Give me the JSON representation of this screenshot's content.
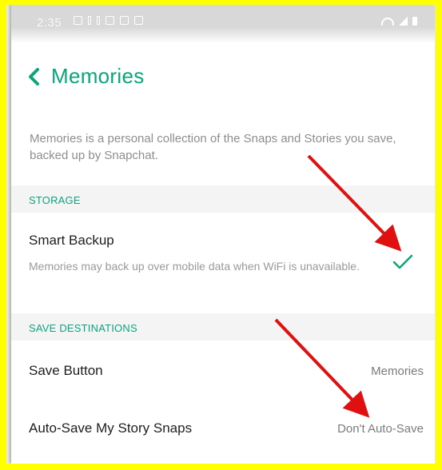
{
  "status_bar": {
    "time": "2:35"
  },
  "header": {
    "title": "Memories"
  },
  "description": "Memories is a personal collection of the Snaps and Stories you save, backed up by Snapchat.",
  "storage": {
    "section_label": "STORAGE",
    "smart_backup": {
      "title": "Smart Backup",
      "subtitle": "Memories may back up over mobile data when WiFi is unavailable.",
      "checked": true
    }
  },
  "save_destinations": {
    "section_label": "SAVE DESTINATIONS",
    "save_button": {
      "title": "Save Button",
      "value": "Memories"
    },
    "auto_save": {
      "title": "Auto-Save My Story Snaps",
      "value": "Don't Auto-Save"
    }
  },
  "colors": {
    "accent": "#0aa57a",
    "highlight_border": "#ffff00",
    "annotation_arrow": "#e01010"
  },
  "icons": [
    "back-icon",
    "check-icon"
  ]
}
